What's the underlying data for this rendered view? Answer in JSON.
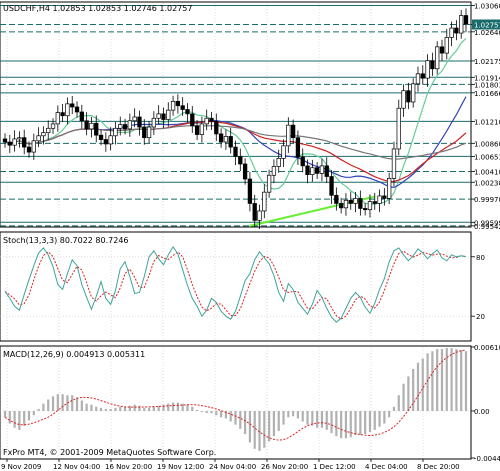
{
  "symbol_header": "USDCHF,H4  1.02853 1.02853 1.02746 1.02757",
  "stoch_header": "Stoch(13,3,3)  80.7022  80.7246",
  "macd_header": "MACD(12,26,9)  0.004913  0.005311",
  "footer": "FxPro MT4, © 2001-2009 MetaQuotes Software Corp.",
  "colors": {
    "background": "#ffffff",
    "grid": "#c8c8c8",
    "levels": "#1a6b6b",
    "candle": "#000000",
    "ma_fast": "#66cc99",
    "ma_mid": "#3344bb",
    "ma_slow": "#cc2222",
    "ma_long": "#777777",
    "trendline": "#66ee33",
    "stoch_main": "#3fa39a",
    "stoch_signal": "#e02020",
    "macd_hist": "#b0b0b0",
    "macd_signal": "#e02020",
    "price_label_bg": "#1a6b6b",
    "price_label_text": "#ffffff"
  },
  "price_axis": {
    "labels": [
      "1.03060",
      "1.02757",
      "1.02640",
      "1.02175",
      "1.01914",
      "1.01801",
      "1.01666",
      "1.01210",
      "1.00860",
      "1.00651",
      "1.00410",
      "1.00238",
      "0.99970",
      "0.99599",
      "0.99542"
    ],
    "current_label": "1.02757"
  },
  "stoch_axis": {
    "labels": [
      "80",
      "20"
    ]
  },
  "macd_axis": {
    "labels": [
      "0.00610",
      "0.00",
      "-0.00448"
    ]
  },
  "time_axis": {
    "labels": [
      "9 Nov 2009",
      "12 Nov 04:00",
      "16 Nov 20:00",
      "19 Nov 12:00",
      "24 Nov 04:00",
      "26 Nov 20:00",
      "1 Dec 12:00",
      "4 Dec 04:00",
      "8 Dec 20:00"
    ]
  },
  "chart_data": {
    "type": "candlestick",
    "symbol": "USDCHF",
    "timeframe": "H4",
    "ohlc_last": {
      "open": 1.02853,
      "high": 1.02853,
      "low": 1.02746,
      "close": 1.02757
    },
    "price_range": [
      0.9954,
      1.031
    ],
    "horizontal_levels": [
      1.0306,
      1.02757,
      1.0264,
      1.02175,
      1.01914,
      1.01801,
      1.01666,
      1.0121,
      1.0086,
      1.00651,
      1.0041,
      1.00238,
      0.9997,
      0.99599,
      0.99542
    ],
    "solid_levels": [
      1.0306,
      1.02175,
      1.01914,
      1.01666,
      1.0121,
      1.00651,
      1.00238,
      0.99599
    ],
    "trendline": {
      "from": {
        "time": "24 Nov 04:00",
        "price": 0.99542
      },
      "to": {
        "time": "7 Dec 04:00",
        "price": 1.0001
      }
    },
    "closes": [
      1.0088,
      1.0083,
      1.0093,
      1.0095,
      1.008,
      1.0072,
      1.009,
      1.0098,
      1.0103,
      1.011,
      1.0117,
      1.0135,
      1.013,
      1.0149,
      1.0144,
      1.0136,
      1.0122,
      1.0109,
      1.0118,
      1.0099,
      1.0092,
      1.0085,
      1.0098,
      1.011,
      1.0116,
      1.0109,
      1.0122,
      1.0128,
      1.0112,
      1.0095,
      1.0112,
      1.0126,
      1.0133,
      1.0124,
      1.0139,
      1.0153,
      1.0146,
      1.014,
      1.0133,
      1.0114,
      1.01,
      1.0117,
      1.0126,
      1.0121,
      1.0101,
      1.0088,
      1.0097,
      1.008,
      1.0065,
      1.0053,
      1.0029,
      0.999,
      0.9963,
      0.9978,
      1.0008,
      1.0035,
      1.0049,
      1.0062,
      1.0082,
      1.0115,
      1.0095,
      1.0064,
      1.005,
      1.0036,
      1.0047,
      1.0038,
      1.005,
      1.0033,
      1.0003,
      0.999,
      0.9983,
      0.9995,
      0.999,
      0.9998,
      0.9982,
      0.998,
      0.9993,
      0.999,
      1.0002,
      0.9998,
      1.003,
      1.0077,
      1.0142,
      1.017,
      1.0152,
      1.0181,
      1.0197,
      1.019,
      1.0218,
      1.0205,
      1.024,
      1.023,
      1.0255,
      1.027,
      1.0262,
      1.029,
      1.0276
    ],
    "stoch_main": [
      45,
      38,
      30,
      26,
      42,
      57,
      71,
      84,
      89,
      82,
      70,
      52,
      47,
      63,
      77,
      71,
      52,
      39,
      27,
      40,
      55,
      38,
      32,
      46,
      68,
      75,
      60,
      43,
      44,
      60,
      80,
      86,
      78,
      72,
      82,
      90,
      83,
      67,
      51,
      38,
      30,
      20,
      26,
      38,
      34,
      25,
      20,
      17,
      25,
      40,
      56,
      63,
      77,
      85,
      79,
      73,
      61,
      44,
      35,
      53,
      47,
      34,
      28,
      22,
      32,
      46,
      39,
      28,
      19,
      14,
      18,
      28,
      38,
      44,
      39,
      29,
      23,
      33,
      47,
      58,
      75,
      86,
      89,
      82,
      76,
      81,
      88,
      84,
      78,
      83,
      87,
      79,
      76,
      82,
      80,
      81,
      80
    ],
    "macd_hist": [
      -0.0006,
      -0.0012,
      -0.0016,
      -0.0018,
      -0.0014,
      -0.0009,
      -0.0004,
      0.0002,
      0.0007,
      0.0011,
      0.0014,
      0.0016,
      0.0016,
      0.0015,
      0.0015,
      0.0013,
      0.001,
      0.0007,
      0.0006,
      0.0004,
      0.0003,
      0.0002,
      0.0002,
      0.0003,
      0.0004,
      0.0004,
      0.0005,
      0.0006,
      0.0005,
      0.0003,
      0.0003,
      0.0004,
      0.0005,
      0.0006,
      0.0007,
      0.0008,
      0.0008,
      0.0007,
      0.0006,
      0.0004,
      0.0001,
      -0.0001,
      -0.0002,
      -0.0002,
      -0.0004,
      -0.0006,
      -0.0007,
      -0.001,
      -0.0013,
      -0.0017,
      -0.0022,
      -0.003,
      -0.0036,
      -0.0038,
      -0.0035,
      -0.0029,
      -0.0024,
      -0.0019,
      -0.0013,
      -0.0006,
      -0.0005,
      -0.0007,
      -0.001,
      -0.0013,
      -0.0014,
      -0.0016,
      -0.0016,
      -0.0018,
      -0.0021,
      -0.0024,
      -0.0026,
      -0.0026,
      -0.0025,
      -0.0023,
      -0.0023,
      -0.0022,
      -0.002,
      -0.0018,
      -0.0015,
      -0.0012,
      -0.0006,
      0.0004,
      0.0015,
      0.0026,
      0.0033,
      0.004,
      0.0046,
      0.005,
      0.0055,
      0.0057,
      0.0059,
      0.0059,
      0.006,
      0.006,
      0.0059,
      0.0058,
      0.0057
    ],
    "macd_range": [
      -0.00448,
      0.0061
    ]
  }
}
